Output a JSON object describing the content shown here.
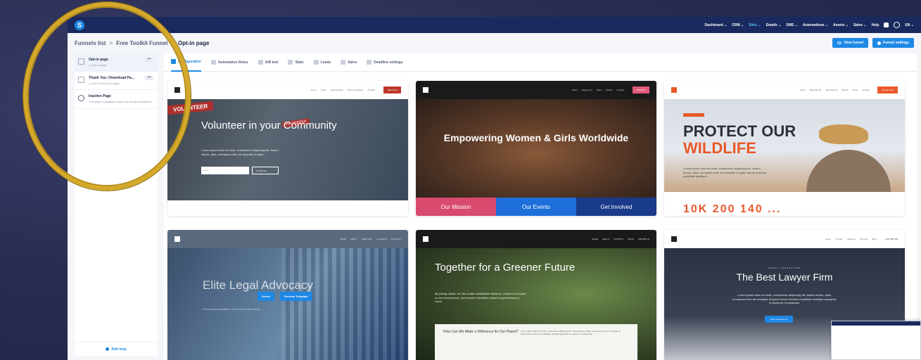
{
  "nav": {
    "logo_letter": "S",
    "items": [
      "Dashboard ⌄",
      "CRM ⌄",
      "Sites ⌄",
      "Emails ⌄",
      "SMS ⌄",
      "Automations ⌄",
      "Assets ⌄",
      "Sales ⌄",
      "Help"
    ],
    "active_index": 2,
    "language": "EN ⌄"
  },
  "breadcrumb": {
    "root": "Funnels list",
    "sep": ">",
    "middle": "Free Toolkit Funnel",
    "current": "Opt-in page"
  },
  "actions": {
    "view_funnel": "View funnel",
    "funnel_settings": "Funnel settings"
  },
  "sidebar": {
    "steps": [
      {
        "title": "Opt-in page",
        "sub": "△ Opt-in page",
        "more": "•••"
      },
      {
        "title": "Thank You / Download Pa...",
        "sub": "△ Opt-in thank you page",
        "more": "•••"
      },
      {
        "title": "Inactive Page",
        "sub": "This page is displayed when the funnel is disabled"
      }
    ],
    "add_step": "Add step"
  },
  "tabs": [
    "Configuration",
    "Automation Rules",
    "A/B test",
    "Stats",
    "Leads",
    "Sales",
    "Deadline settings"
  ],
  "cards": {
    "c1": {
      "links": [
        "Home",
        "About",
        "Opportunities",
        "How to Volunteer",
        "Contact"
      ],
      "cta": "Start Now",
      "badge": "VOLUNTEER",
      "badge2": "VOLUNTEER",
      "title": "Volunteer in your Community",
      "text": "Lorem ipsum dolor sit amet, consectetur adipiscing elit. Autem dolore, alias, numquam enim ab voluptate id quam",
      "email": "Email",
      "contact": "Contact Us"
    },
    "c2": {
      "links": [
        "About",
        "Support Us",
        "News",
        "Events",
        "Contact"
      ],
      "cta": "DONATE",
      "title": "Empowering Women & Girls Worldwide",
      "tri": [
        "Our Mission",
        "Our Events",
        "Get Involved"
      ],
      "tri_colors": [
        "#d84a6e",
        "#1e6fd9",
        "#1a3a8a"
      ]
    },
    "c3": {
      "links": [
        "About",
        "What We Do",
        "Who We Are",
        "Events",
        "News",
        "Contact"
      ],
      "cta": "Donate Now",
      "title1": "PROTECT OUR",
      "title2": "WILDLIFE",
      "text": "Lorem ipsum dolor sit amet, consectetur adipiscing elit. Autem dolore, alias, numquam enim ab voluptate id quam harum ducimus cupiditate similique.",
      "stats": "10K   200   140   ..."
    },
    "c4": {
      "links": [
        "HOME",
        "ABOUT",
        "SERVICES",
        "LAWYERS",
        "CONTACT"
      ],
      "title": "Elite Legal Advocacy",
      "text": "Personalized guidance for all your legal needs",
      "select": "Select",
      "preview": "Preview Template"
    },
    "c5": {
      "links": [
        "HOME",
        "ABOUT",
        "CONTACT",
        "BLOG",
        "PROJECTS"
      ],
      "title": "Together for a Greener Future",
      "text": "By joining hands, we can create sustainable solutions, reduce our impact on the environment, and ensure a healthier planet for generations to come",
      "box_q": "How Can We Make a Difference for Our Planet?",
      "box_t": "Lorem ipsum dolor sit amet, consectetur adipiscing elit. Autem dolore, alias, numquam enim ab voluptate id quam harum ducimus cupiditate similique quisquam et deserunt, recusandae."
    },
    "c6": {
      "links": [
        "Home",
        "Contact",
        "About Us",
        "Services",
        "Blog"
      ],
      "phone": "+123 456 789",
      "kicker": "LEGAL CONSULTING",
      "title": "The Best Lawyer Firm",
      "text": "Lorem ipsum dolor sit amet, consectetur adipiscing elit. Autem dolore, alias, numquam enim ab voluptate id quam harum ducimus cupiditate similique quisquam et deserunt, recusandae.",
      "appt": "Book Appointment"
    }
  },
  "colors": {
    "nav_bg": "#1a2a5e",
    "accent": "#1e88e5",
    "highlight_ring": "#d4a82a"
  }
}
